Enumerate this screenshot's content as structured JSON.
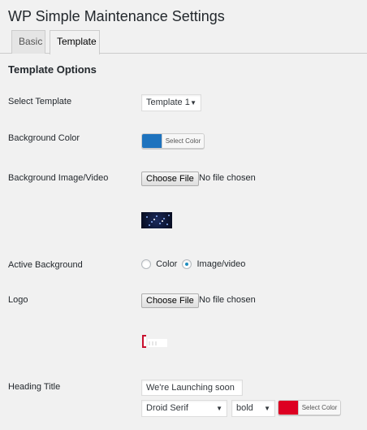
{
  "header": {
    "title": "WP Simple Maintenance Settings"
  },
  "tabs": [
    {
      "label": "Basic",
      "active": false
    },
    {
      "label": "Template",
      "active": true
    }
  ],
  "section": {
    "title": "Template Options"
  },
  "fields": {
    "select_template": {
      "label": "Select Template",
      "value": "Template 1"
    },
    "background_color": {
      "label": "Background Color",
      "color": "#1e73be",
      "button_label": "Select Color"
    },
    "background_media": {
      "label": "Background Image/Video",
      "button_label": "Choose File",
      "status": "No file chosen"
    },
    "active_background": {
      "label": "Active Background",
      "options": [
        {
          "label": "Color",
          "checked": false
        },
        {
          "label": "Image/video",
          "checked": true
        }
      ]
    },
    "logo": {
      "label": "Logo",
      "button_label": "Choose File",
      "status": "No file chosen"
    },
    "heading_title": {
      "label": "Heading Title",
      "value": "We're Launching soon",
      "font_family": "Droid Serif",
      "font_weight": "bold",
      "color": "#dd0022",
      "color_button_label": "Select Color"
    }
  },
  "icons": {
    "dropdown_arrow": "triangle-down",
    "video_thumbnail": "starfield-thumbnail",
    "logo_thumbnail": "red-logo-thumbnail"
  },
  "colors": {
    "accent": "#1e8cbe",
    "background": "#f1f1f1"
  }
}
